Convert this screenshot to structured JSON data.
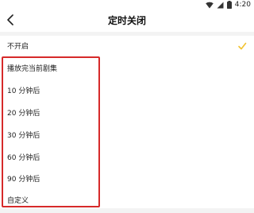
{
  "status_bar": {
    "time": "4:20",
    "icons": [
      "wifi-icon",
      "signal-icon",
      "battery-icon"
    ]
  },
  "header": {
    "back_icon": "chevron-left-icon",
    "title": "定时关闭"
  },
  "options": [
    {
      "label": "不开启",
      "selected": true
    },
    {
      "label": "播放完当前剧集",
      "selected": false
    },
    {
      "label": "10 分钟后",
      "selected": false
    },
    {
      "label": "20 分钟后",
      "selected": false
    },
    {
      "label": "30 分钟后",
      "selected": false
    },
    {
      "label": "60 分钟后",
      "selected": false
    },
    {
      "label": "90 分钟后",
      "selected": false
    },
    {
      "label": "自定义",
      "selected": false
    }
  ],
  "colors": {
    "check": "#f2c230",
    "highlight_border": "#d62a2a"
  }
}
